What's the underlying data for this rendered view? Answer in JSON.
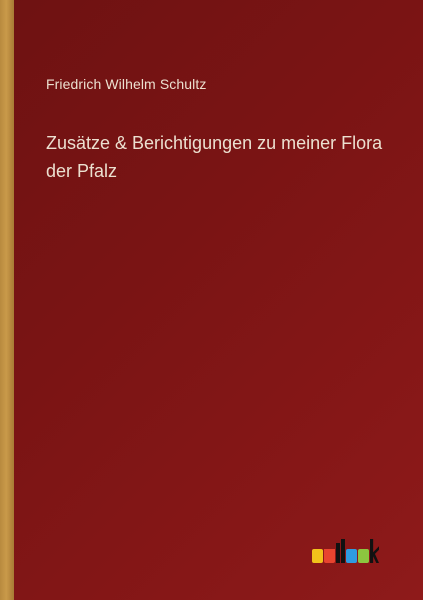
{
  "cover": {
    "author": "Friedrich Wilhelm Schultz",
    "title_line1": "Zusätze & Berichtigungen zu meiner Flora",
    "title_line2": "der Pfalz"
  },
  "logo": {
    "text": "outlook",
    "colors": {
      "o1": "#f2c21b",
      "u": "#e8442f",
      "t": "#111111",
      "l": "#111111",
      "o2": "#2f9be0",
      "o3": "#8cc63f",
      "k": "#111111"
    }
  },
  "palette": {
    "background": "#7a1414",
    "spine": "#c99a4a",
    "text": "#ece0d0"
  }
}
